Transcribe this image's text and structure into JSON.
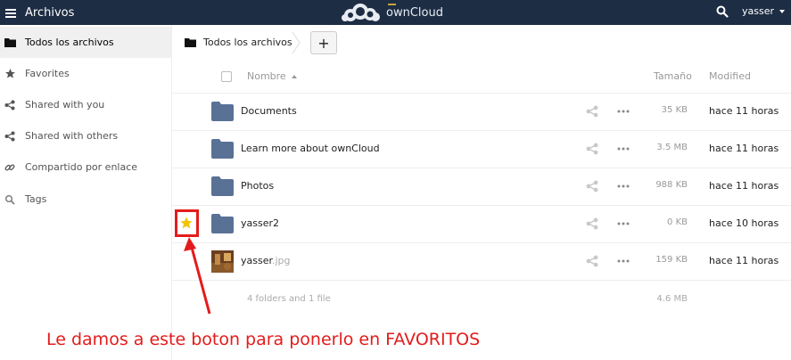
{
  "header": {
    "app_title": "Archivos",
    "logo_text": "ownCloud",
    "user_name": "yasser",
    "bg_color": "#1d2d44"
  },
  "sidebar": {
    "items": [
      {
        "label": "Todos los archivos",
        "icon": "folder-icon",
        "active": true
      },
      {
        "label": "Favorites",
        "icon": "star-icon",
        "active": false
      },
      {
        "label": "Shared with you",
        "icon": "share-icon",
        "active": false
      },
      {
        "label": "Shared with others",
        "icon": "share-icon",
        "active": false
      },
      {
        "label": "Compartido por enlace",
        "icon": "link-icon",
        "active": false
      },
      {
        "label": "Tags",
        "icon": "tag-icon",
        "active": false
      }
    ]
  },
  "breadcrumb": {
    "home_label": "Todos los archivos",
    "new_button": "+"
  },
  "table": {
    "columns": {
      "name": "Nombre",
      "size": "Tamaño",
      "modified": "Modified"
    },
    "rows": [
      {
        "name": "Documents",
        "ext": "",
        "type": "folder",
        "size": "35 KB",
        "modified": "hace 11 horas",
        "favorite": false
      },
      {
        "name": "Learn more about ownCloud",
        "ext": "",
        "type": "folder",
        "size": "3.5 MB",
        "modified": "hace 11 horas",
        "favorite": false
      },
      {
        "name": "Photos",
        "ext": "",
        "type": "folder",
        "size": "988 KB",
        "modified": "hace 11 horas",
        "favorite": false
      },
      {
        "name": "yasser2",
        "ext": "",
        "type": "folder",
        "size": "0 KB",
        "modified": "hace 10 horas",
        "favorite": true
      },
      {
        "name": "yasser",
        "ext": ".jpg",
        "type": "image",
        "size": "159 KB",
        "modified": "hace 11 horas",
        "favorite": false
      }
    ],
    "summary": {
      "count": "4 folders and 1 file",
      "total_size": "4.6 MB"
    }
  },
  "annotation": {
    "text": "Le damos a este boton para ponerlo en FAVORITOS",
    "color": "#e41b1b"
  },
  "colors": {
    "folder": "#5a7196",
    "favorite_star": "#f5c400",
    "annotation": "#e41b1b"
  }
}
